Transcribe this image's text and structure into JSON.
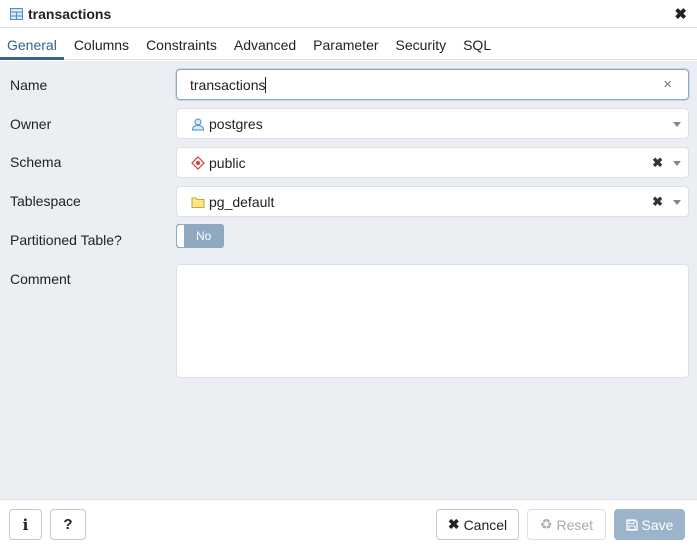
{
  "dialog": {
    "title": "transactions",
    "title_icon": "table-icon",
    "close_icon": "close-icon"
  },
  "tabs": [
    {
      "label": "General",
      "active": true
    },
    {
      "label": "Columns",
      "active": false
    },
    {
      "label": "Constraints",
      "active": false
    },
    {
      "label": "Advanced",
      "active": false
    },
    {
      "label": "Parameter",
      "active": false
    },
    {
      "label": "Security",
      "active": false
    },
    {
      "label": "SQL",
      "active": false
    }
  ],
  "form": {
    "name": {
      "label": "Name",
      "value": "transactions",
      "clear_icon": "×"
    },
    "owner": {
      "label": "Owner",
      "value": "postgres",
      "icon": "user-icon"
    },
    "schema": {
      "label": "Schema",
      "value": "public",
      "icon": "schema-icon",
      "clear": "✖"
    },
    "tablespace": {
      "label": "Tablespace",
      "value": "pg_default",
      "icon": "folder-icon",
      "clear": "✖"
    },
    "partitioned": {
      "label": "Partitioned Table?",
      "value": "No"
    },
    "comment": {
      "label": "Comment",
      "value": ""
    }
  },
  "footer": {
    "info_label": "i",
    "help_label": "?",
    "cancel_label": "Cancel",
    "cancel_icon": "✖",
    "reset_label": "Reset",
    "reset_icon": "♻",
    "save_label": "Save"
  },
  "colors": {
    "accent": "#326690",
    "body_bg": "#ebeef3",
    "save_bg": "#9bb4c9",
    "toggle_bg": "#8ea9c0"
  }
}
